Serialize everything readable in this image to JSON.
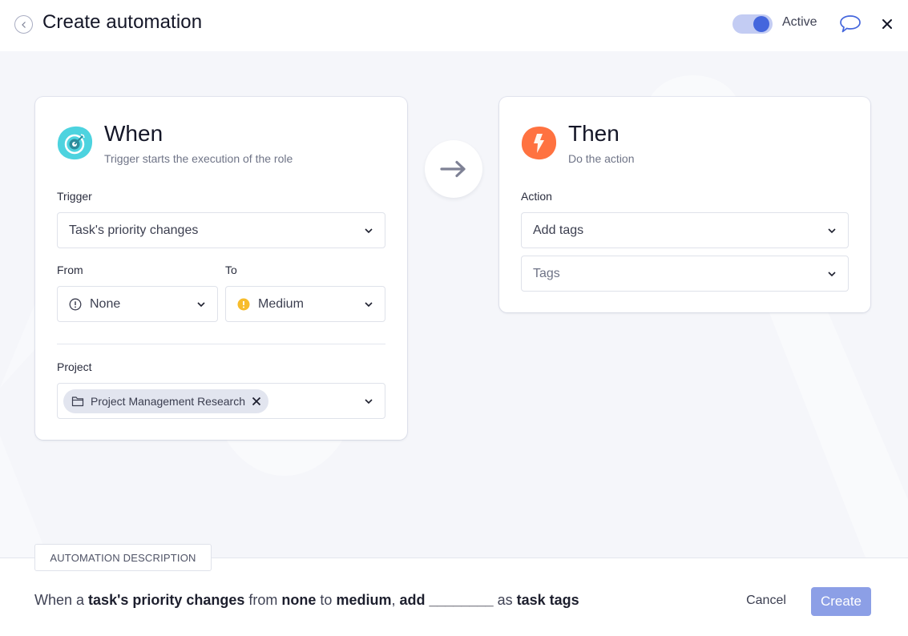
{
  "header": {
    "title": "Create automation",
    "toggle_label": "Active",
    "toggle_on": true,
    "icons": {
      "back": "chevron-left-icon",
      "chat": "chat-bubble-icon",
      "close": "close-icon"
    }
  },
  "when_card": {
    "title": "When",
    "subtitle": "Trigger starts the execution of the role",
    "icon": "target-icon",
    "icon_color": "#4dd3df",
    "trigger": {
      "label": "Trigger",
      "value": "Task's priority changes"
    },
    "from": {
      "label": "From",
      "value": "None",
      "icon": "priority-none-icon"
    },
    "to": {
      "label": "To",
      "value": "Medium",
      "icon": "priority-medium-icon",
      "icon_color": "#f7bc2b"
    },
    "project": {
      "label": "Project",
      "chip": "Project Management Research",
      "chip_icon": "folder-icon"
    }
  },
  "arrow": {
    "icon": "arrow-right-icon"
  },
  "then_card": {
    "title": "Then",
    "subtitle": "Do the action",
    "icon": "lightning-icon",
    "icon_color": "#ff7240",
    "action": {
      "label": "Action",
      "value": "Add tags"
    },
    "tags": {
      "placeholder": "Tags"
    }
  },
  "footer": {
    "tab_label": "AUTOMATION DESCRIPTION",
    "description": {
      "p1": "When a ",
      "b1": "task's priority changes",
      "p2": " from ",
      "b2": "none",
      "p3": " to ",
      "b3": "medium",
      "p4": ", ",
      "b4": "add",
      "p5": " ",
      "b5": "________",
      "p6": " as ",
      "b6": "task tags"
    },
    "cancel_label": "Cancel",
    "create_label": "Create"
  },
  "colors": {
    "accent": "#4466dd",
    "create_button": "#8c9fe6",
    "background": "#f5f6fa"
  }
}
